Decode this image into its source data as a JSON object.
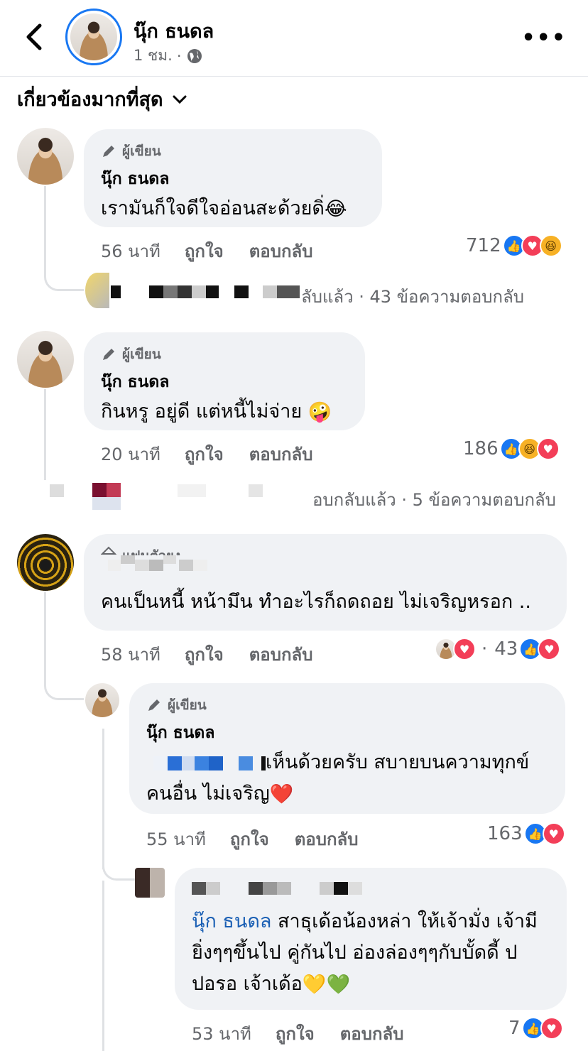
{
  "header": {
    "name": "นุ๊ก ธนดล",
    "time": "1 ชม.",
    "separator": "·"
  },
  "sort_label": "เกี่ยวข้องมากที่สุด",
  "labels": {
    "author": "ผู้เขียน",
    "like": "ถูกใจ",
    "reply": "ตอบกลับ"
  },
  "comments": [
    {
      "name": "นุ๊ก ธนดล",
      "text": "เรามันก็ใจดีใจอ่อนสะด้วยดิ่",
      "emoji": "😂",
      "time": "56 นาที",
      "reactions": "712",
      "reply_summary": "ลับแล้ว · 43 ข้อความตอบกลับ"
    },
    {
      "name": "นุ๊ก ธนดล",
      "text": "กินหรู อยู่ดี แต่หนี้ไม่จ่าย",
      "emoji": "🤪",
      "time": "20 นาที",
      "reactions": "186",
      "reply_summary": "อบกลับแล้ว · 5 ข้อความตอบกลับ"
    },
    {
      "badge_partial": "แฟนตัวยง",
      "text": "คนเป็นหนี้ หน้ามึน ทำอะไรก็ถดถอย ไม่เจริญหรอก ..",
      "time": "58 นาที",
      "reactions": "43",
      "dot": "·"
    }
  ],
  "replies": [
    {
      "name": "นุ๊ก ธนดล",
      "text_line1": "เห็นด้วยครับ สบายบนความทุกข์",
      "text_line2": "คนอื่น ไม่เจริญ",
      "emoji": "❤️",
      "time": "55 นาที",
      "reactions": "163"
    },
    {
      "mention": "นุ๊ก ธนดล",
      "text_line1": " สาธุเด้อน้องหล่า ให้เจ้ามั่ง เจ้ามี",
      "text_line2": "ยิ่งๆๆขึ้นไป คู่กันไป อ่องล่องๆๆกับบั้ดดี้ ป",
      "text_line3": "ปอรอ เจ้าเด้อ",
      "emoji": "💛💚",
      "time": "53 นาที",
      "reactions": "7"
    }
  ],
  "colors": {
    "accent": "#1877f2",
    "bubble": "#f0f2f5",
    "secondary_text": "#65676b"
  }
}
